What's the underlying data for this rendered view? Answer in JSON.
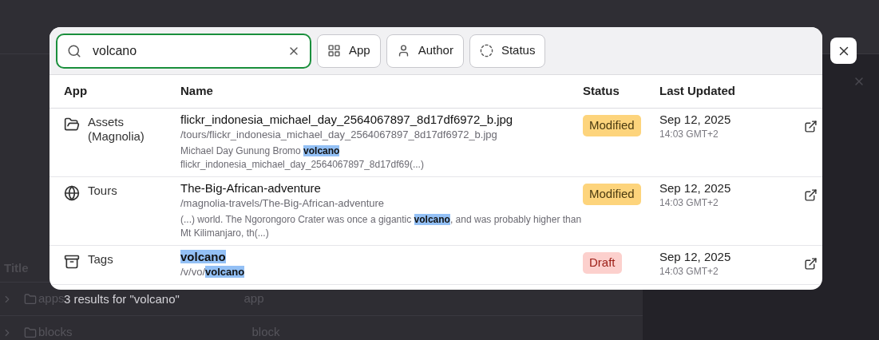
{
  "background": {
    "table_header": "Title",
    "rows": [
      {
        "title": "apps",
        "type": "app"
      },
      {
        "title": "blocks",
        "type": "block"
      }
    ]
  },
  "search": {
    "value": "volcano",
    "filters": [
      {
        "label": "App",
        "kind": "app"
      },
      {
        "label": "Author",
        "kind": "author"
      },
      {
        "label": "Status",
        "kind": "status"
      }
    ]
  },
  "table": {
    "columns": [
      "App",
      "Name",
      "Status",
      "Last Updated"
    ],
    "rows": [
      {
        "app": "Assets (Magnolia)",
        "kind": "folder",
        "name": [
          {
            "text": "flickr_indonesia_michael_day_2564067897_8d17df6972_b.jpg",
            "highlight": false
          }
        ],
        "path": [
          {
            "text": "/tours/flickr_indonesia_michael_day_2564067897_8d17df6972_b.jpg",
            "highlight": false
          }
        ],
        "snippet": [
          {
            "text": "Michael Day Gunung Bromo ",
            "highlight": false
          },
          {
            "text": "volcano",
            "highlight": true
          },
          {
            "text": " flickr_indonesia_michael_day_2564067897_8d17df69(...)",
            "highlight": false
          }
        ],
        "status": {
          "text": "Modified",
          "kind": "modified"
        },
        "date": "Sep 12, 2025",
        "time": "14:03 GMT+2"
      },
      {
        "app": "Tours",
        "kind": "globe",
        "name": [
          {
            "text": "The-Big-African-adventure",
            "highlight": false
          }
        ],
        "path": [
          {
            "text": "/magnolia-travels/The-Big-African-adventure",
            "highlight": false
          }
        ],
        "snippet": [
          {
            "text": "(...) world. The Ngorongoro Crater was once a gigantic ",
            "highlight": false
          },
          {
            "text": "volcano",
            "highlight": true
          },
          {
            "text": ", and was probably higher than Mt Kilimanjaro, th(...)",
            "highlight": false
          }
        ],
        "status": {
          "text": "Modified",
          "kind": "modified"
        },
        "date": "Sep 12, 2025",
        "time": "14:03 GMT+2"
      },
      {
        "app": "Tags",
        "kind": "archive",
        "name": [
          {
            "text": "volcano",
            "highlight": true
          }
        ],
        "path": [
          {
            "text": "/v/vo/",
            "highlight": false
          },
          {
            "text": "volcano",
            "highlight": true
          }
        ],
        "snippet": [],
        "status": {
          "text": "Draft",
          "kind": "draft"
        },
        "date": "Sep 12, 2025",
        "time": "14:03 GMT+2"
      }
    ]
  },
  "results_summary": "3 results for \"volcano\""
}
